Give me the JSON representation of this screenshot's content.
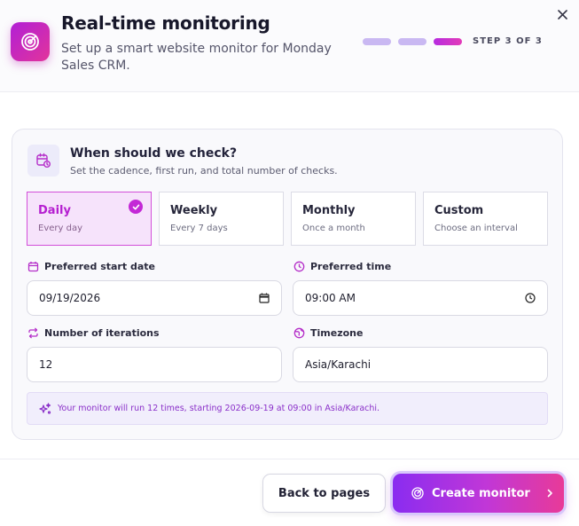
{
  "header": {
    "title": "Real-time monitoring",
    "subtitle": "Set up a smart website monitor for Monday Sales CRM.",
    "step_label": "STEP 3 OF 3",
    "steps_total": 3,
    "current_step": 3
  },
  "schedule": {
    "title": "When should we check?",
    "description": "Set the cadence, first run, and total number of checks.",
    "cadences": [
      {
        "name": "Daily",
        "sub": "Every day",
        "selected": true
      },
      {
        "name": "Weekly",
        "sub": "Every 7 days",
        "selected": false
      },
      {
        "name": "Monthly",
        "sub": "Once a month",
        "selected": false
      },
      {
        "name": "Custom",
        "sub": "Choose an interval",
        "selected": false
      }
    ],
    "start_date": {
      "label": "Preferred start date",
      "value": "09/19/2026"
    },
    "start_time": {
      "label": "Preferred time",
      "value": "09:00 AM"
    },
    "iterations": {
      "label": "Number of iterations",
      "value": "12"
    },
    "timezone": {
      "label": "Timezone",
      "value": "Asia/Karachi"
    },
    "summary": "Your monitor will run 12 times, starting 2026-09-19 at 09:00 in Asia/Karachi."
  },
  "footer": {
    "back_label": "Back to pages",
    "create_label": "Create monitor"
  },
  "colors": {
    "accent": "#c328d6",
    "accent_gradient_start": "#8a2cf0",
    "accent_gradient_end": "#e83a98",
    "info_text": "#8a2fc9"
  }
}
